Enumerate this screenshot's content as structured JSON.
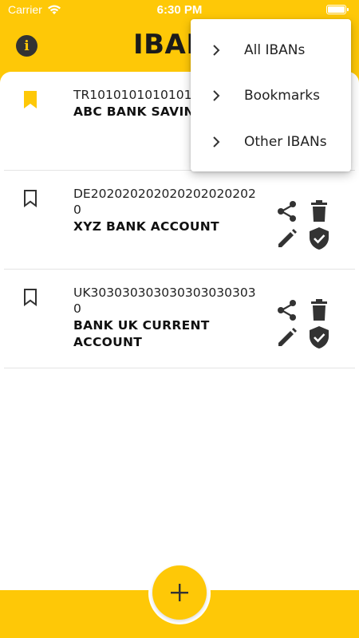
{
  "status_bar": {
    "carrier": "Carrier",
    "time": "6:30 PM"
  },
  "header": {
    "title": "IBANs",
    "info_icon": "info-icon",
    "info_glyph": "i"
  },
  "ibans": [
    {
      "iban": "TR1010101010101010",
      "name": "ABC BANK SAVING",
      "bookmarked": true
    },
    {
      "iban": "DE2020202020202020202020",
      "name": "XYZ BANK ACCOUNT",
      "bookmarked": false
    },
    {
      "iban": "UK3030303030303030303030",
      "name": "BANK UK CURRENT ACCOUNT",
      "bookmarked": false
    }
  ],
  "menu": {
    "items": [
      {
        "label": "All IBANs"
      },
      {
        "label": "Bookmarks"
      },
      {
        "label": "Other IBANs"
      }
    ]
  },
  "fab": {
    "icon": "plus-icon"
  },
  "colors": {
    "accent": "#fec807",
    "icon": "#333333",
    "surface": "#ffffff"
  }
}
